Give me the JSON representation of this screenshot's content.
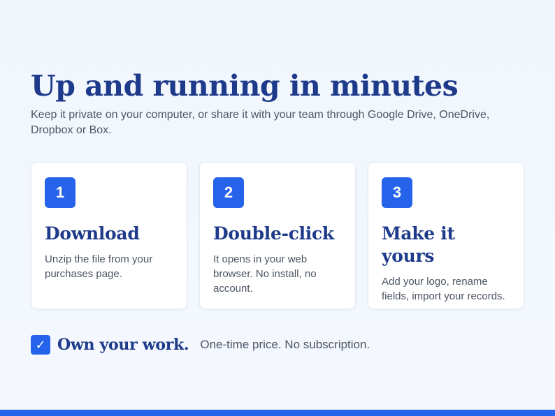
{
  "hero": {
    "title": "Up and running in minutes",
    "subtitle": "Keep it private on your computer, or share it with your team through Google Drive, OneDrive, Dropbox or Box."
  },
  "steps": [
    {
      "number": "1",
      "title": "Download",
      "text": "Unzip the file from your purchases page."
    },
    {
      "number": "2",
      "title": "Double-click",
      "text": "It opens in your web browser. No install, no account."
    },
    {
      "number": "3",
      "title": "Make it yours",
      "text": "Add your logo, rename fields, import your records."
    }
  ],
  "ownership": {
    "check_glyph": "✓",
    "title": "Own your work.",
    "text": "One-time price. No subscription."
  },
  "colors": {
    "accent": "#2563eb",
    "heading": "#1e3a8a",
    "body_text": "#4b5563",
    "background": "#f1f6fd"
  }
}
